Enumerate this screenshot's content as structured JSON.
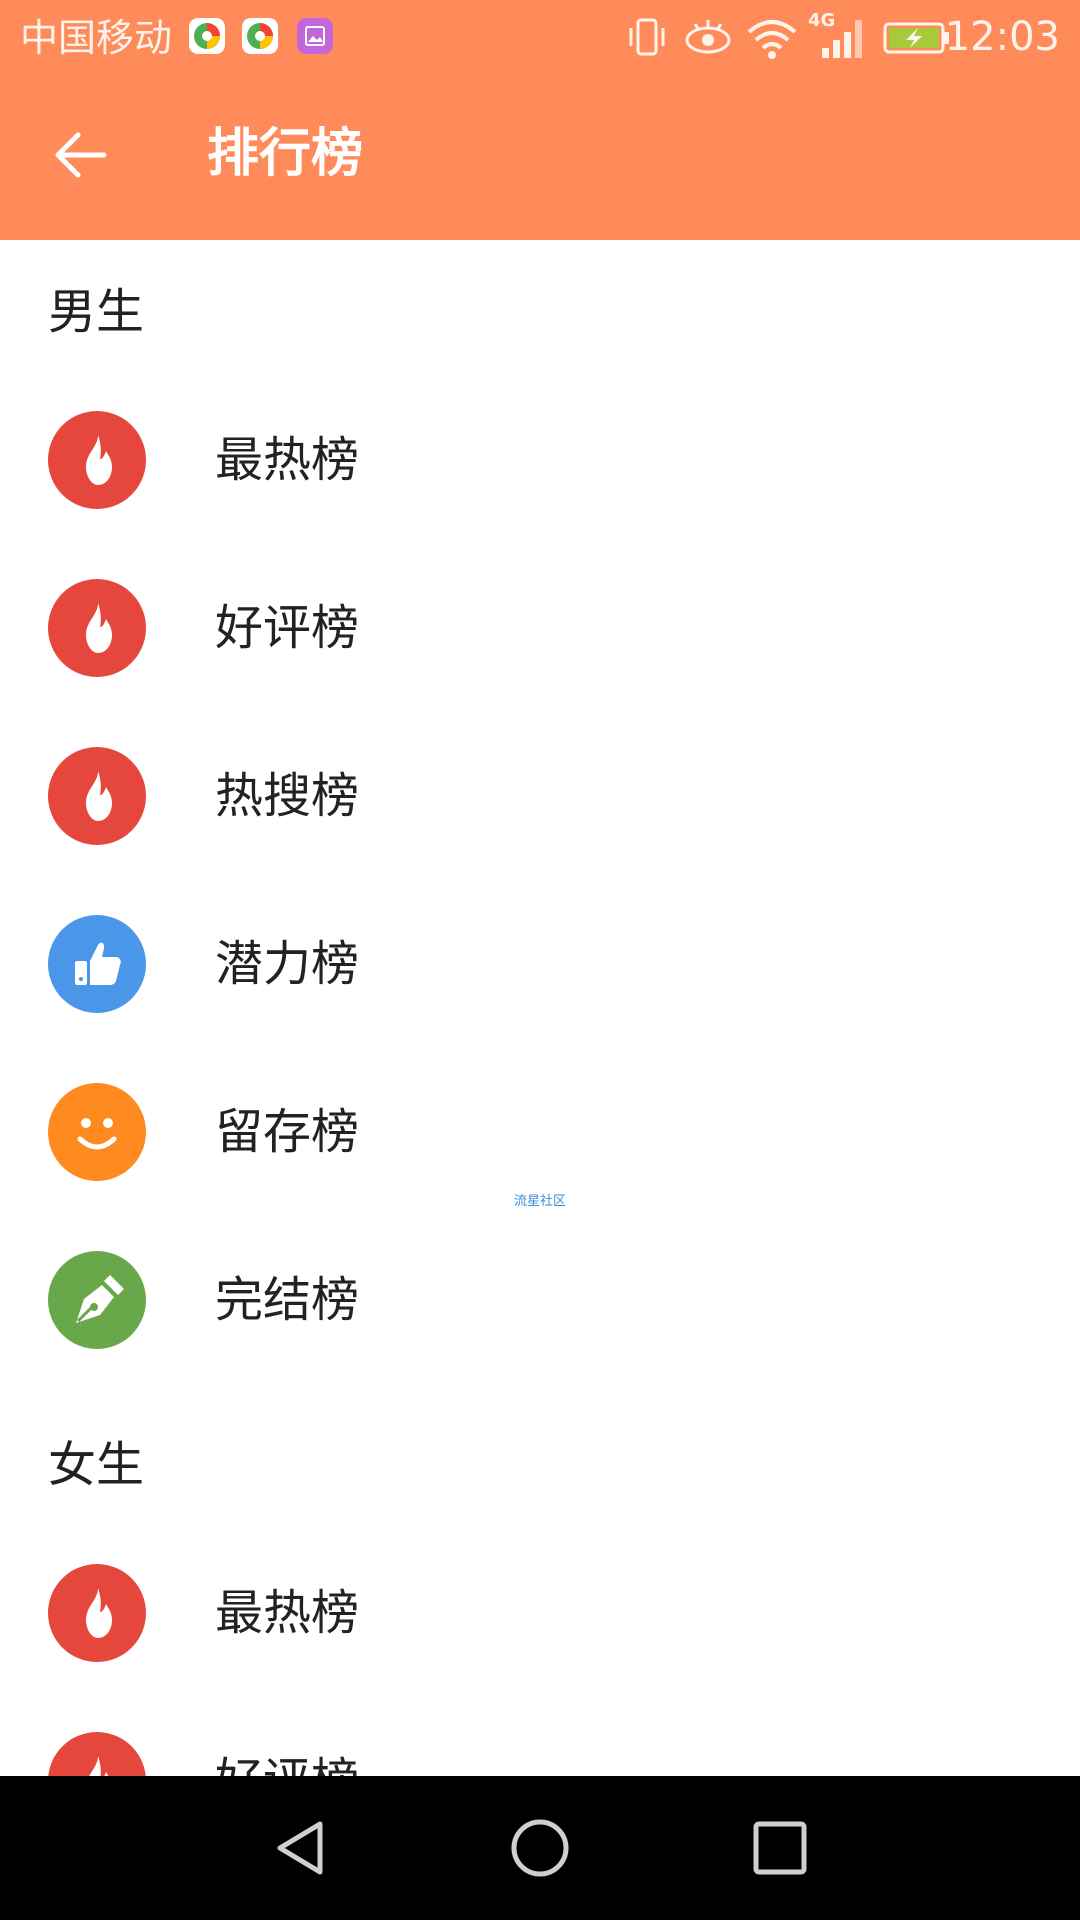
{
  "status_bar": {
    "carrier": "中国移动",
    "network": "4G",
    "time": "12:03",
    "icons": [
      "app-notification-icon",
      "app-notification-icon",
      "gallery-notification-icon",
      "vibrate-icon",
      "eye-icon",
      "wifi-icon",
      "signal-icon",
      "battery-charging-icon"
    ]
  },
  "toolbar": {
    "title": "排行榜",
    "back_icon": "arrow-left-icon",
    "background": "#ff8b5b"
  },
  "sections": [
    {
      "title": "男生",
      "items": [
        {
          "label": "最热榜",
          "icon": "flame-icon",
          "color": "#e5473d"
        },
        {
          "label": "好评榜",
          "icon": "flame-icon",
          "color": "#e5473d"
        },
        {
          "label": "热搜榜",
          "icon": "flame-icon",
          "color": "#e5473d"
        },
        {
          "label": "潜力榜",
          "icon": "thumbs-up-icon",
          "color": "#4a96e8"
        },
        {
          "label": "留存榜",
          "icon": "smiley-icon",
          "color": "#ff8a20"
        },
        {
          "label": "完结榜",
          "icon": "pen-nib-icon",
          "color": "#69a84a"
        }
      ]
    },
    {
      "title": "女生",
      "items": [
        {
          "label": "最热榜",
          "icon": "flame-icon",
          "color": "#e5473d"
        },
        {
          "label": "好评榜",
          "icon": "flame-icon",
          "color": "#e5473d"
        }
      ]
    }
  ],
  "watermark": "流星社区",
  "nav_bar": {
    "buttons": [
      "nav-back-icon",
      "nav-home-icon",
      "nav-recent-icon"
    ]
  }
}
